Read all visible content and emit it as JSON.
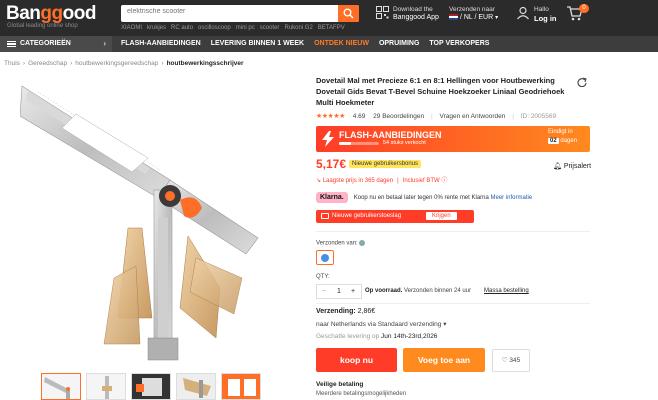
{
  "header": {
    "logo_main": "Ban",
    "logo_gg": "gg",
    "logo_end": "ood",
    "logo_tagline": "Global leading online shop",
    "search_placeholder": "elektrische scooter",
    "hotwords": [
      "XIAOMI",
      "krukjes",
      "RC auto",
      "oscilloscoop",
      "mini pc",
      "scooter",
      "Rukoni G2",
      "BETAFPV"
    ],
    "app_line1": "Download the",
    "app_line2": "Banggood App",
    "ship_line1": "Verzenden naar",
    "ship_line2": "/ NL / EUR",
    "account_line1": "Hallo",
    "account_line2": "Log in",
    "cart_count": "0"
  },
  "nav": {
    "categories": "CATEGORIEËN",
    "links": [
      "FLASH-AANBIEDINGEN",
      "LEVERING BINNEN 1 WEEK",
      "ONTDEK NIEUW",
      "OPRUIMING",
      "TOP VERKOPERS"
    ]
  },
  "breadcrumb": [
    "Thuis",
    "Gereedschap",
    "houtbewerkingsgereedschap",
    "houtbewerkingsschrijver"
  ],
  "product": {
    "title": "Dovetail Mal met Precieze 6:1 en 8:1 Hellingen voor Houtbewerking Dovetail Gids Bevat T-Bevel Schuine Hoekzoeker Liniaal Geodriehoek Multi Hoekmeter",
    "stars": "★★★★★",
    "rating": "4.69",
    "reviews": "29 Beoordelingen",
    "qa": "Vragen en Antwoorden",
    "id": "ID: 2005569"
  },
  "flash": {
    "title": "FLASH-AANBIEDINGEN",
    "sold": "54 stuks verkocht",
    "sold_fraction": 0.3,
    "ends_label": "Eindigt in",
    "days_num": "02",
    "days_label": "dagen"
  },
  "price": {
    "value": "5,17€",
    "badge": "Nieuwe gebruikersbonus",
    "alert": "Prijsalert",
    "lowest": "Laagste prijs in 365 dagen",
    "vat": "Inclusief BTW"
  },
  "klarna": {
    "logo": "Klarna.",
    "text": "Koop nu en betaal later tegen 0% rente met Klarna",
    "more": "Meer informatie"
  },
  "coupon": {
    "label": "Nieuwe gebruikerstoeslag",
    "button": "Krijgen"
  },
  "shipping": {
    "from_label": "Verzonden van:",
    "qty_label": "QTY:",
    "qty_value": "1",
    "qty_note_bold": "Op voorraad.",
    "qty_note": "Verzonden binnen 24 uur",
    "bulk": "Massa bestelling",
    "cost_label": "Verzending:",
    "cost_value": "2,86€",
    "via": "naar Netherlands via Standaard verzending",
    "eta_label": "Geschatte levering op",
    "eta_value": "Jun 14th-23rd,2026"
  },
  "actions": {
    "buy": "koop nu",
    "cart": "Voeg toe aan",
    "wish_count": "345"
  },
  "secure": {
    "title": "Veilige betaling",
    "text": "Meerdere betalingsmogelijkheden"
  }
}
